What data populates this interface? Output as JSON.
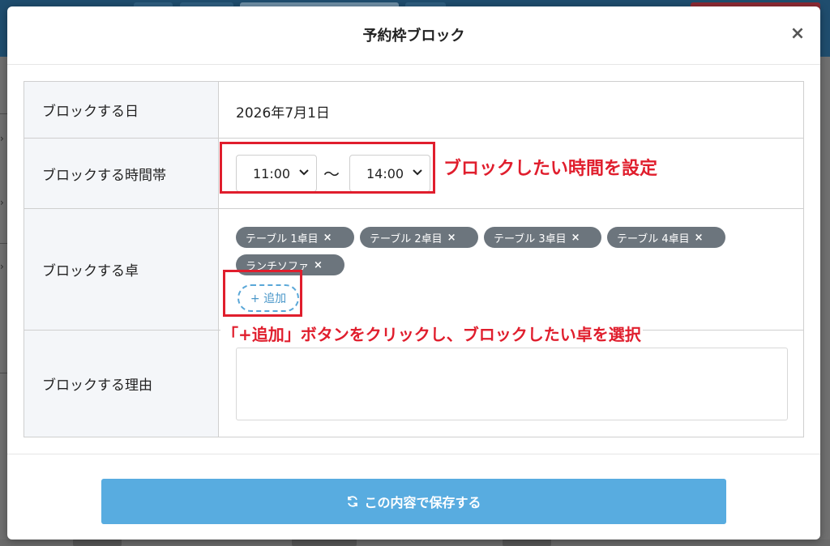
{
  "modal": {
    "title": "予約枠ブロック",
    "close_icon": "×"
  },
  "form": {
    "date": {
      "label": "ブロックする日",
      "value": "2026年7月1日"
    },
    "time": {
      "label": "ブロックする時間帯",
      "start": "11:00",
      "separator": "～",
      "end": "14:00"
    },
    "tables": {
      "label": "ブロックする卓",
      "tags": [
        {
          "label": "テーブル 1卓目",
          "remove": "×"
        },
        {
          "label": "テーブル 2卓目",
          "remove": "×"
        },
        {
          "label": "テーブル 3卓目",
          "remove": "×"
        },
        {
          "label": "テーブル 4卓目",
          "remove": "×"
        },
        {
          "label": "ランチソファ",
          "remove": "×"
        }
      ],
      "add_button": "+ 追加"
    },
    "reason": {
      "label": "ブロックする理由",
      "value": ""
    }
  },
  "annotations": {
    "time_note": "ブロックしたい時間を設定",
    "add_note": "「+追加」ボタンをクリックし、ブロックしたい卓を選択"
  },
  "footer": {
    "save_label": "この内容で保存する",
    "save_icon": "refresh-icon"
  },
  "colors": {
    "accent": "#58ace0",
    "tag_bg": "#6c757d",
    "annotation": "#e01e2d",
    "label_bg": "#f4f6f9"
  }
}
